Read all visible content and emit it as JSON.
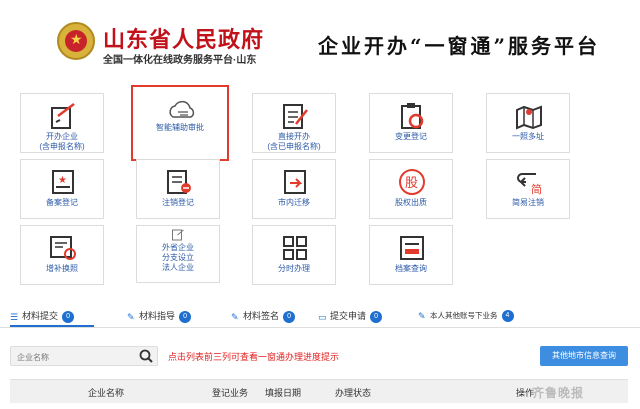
{
  "header": {
    "gov_title": "山东省人民政府",
    "gov_subtitle": "全国一体化在线政务服务平台·山东",
    "platform_title": "企业开办“一窗通”服务平台"
  },
  "tiles": [
    {
      "label": "开办企业",
      "label2": "(含申报名称)",
      "icon": "edit-document-icon"
    },
    {
      "label": "智能辅助审批",
      "label2": "",
      "icon": "cloud-icon",
      "highlighted": true
    },
    {
      "label": "直接开办",
      "label2": "(含已申报名称)",
      "icon": "pen-document-icon"
    },
    {
      "label": "变更登记",
      "label2": "",
      "icon": "refresh-clipboard-icon"
    },
    {
      "label": "一照多址",
      "label2": "",
      "icon": "map-icon"
    },
    {
      "label": "备案登记",
      "label2": "",
      "icon": "star-folder-icon"
    },
    {
      "label": "注销登记",
      "label2": "",
      "icon": "cancel-document-icon"
    },
    {
      "label": "市内迁移",
      "label2": "",
      "icon": "move-document-icon"
    },
    {
      "label": "股权出质",
      "label2": "",
      "icon": "stock-icon",
      "icon_text": "股"
    },
    {
      "label": "简易注销",
      "label2": "",
      "icon": "simple-cancel-icon",
      "icon_text": "简"
    },
    {
      "label": "增补换照",
      "label2": "",
      "icon": "certificate-icon"
    },
    {
      "label": "外省企业",
      "label2": "分支设立",
      "label3": "法人企业",
      "icon": "branch-icon"
    },
    {
      "label": "分时办理",
      "label2": "",
      "icon": "grid-icon"
    },
    {
      "label": "档案查询",
      "label2": "",
      "icon": "archive-icon"
    }
  ],
  "tabs": [
    {
      "label": "材料提交",
      "count": "0",
      "active": true
    },
    {
      "label": "材料指导",
      "count": "0"
    },
    {
      "label": "材料签名",
      "count": "0"
    },
    {
      "label": "提交申请",
      "count": "0"
    },
    {
      "label": "本人其他账号下业务",
      "count": "4"
    }
  ],
  "search": {
    "placeholder": "企业名称"
  },
  "hint": "点击列表前三列可查看一窗通办理进度提示",
  "query_button": "其他地市信息查询",
  "table": {
    "columns": [
      "企业名称",
      "登记业务",
      "填报日期",
      "办理状态",
      "操作"
    ]
  },
  "watermark": "齐鲁晚报",
  "colors": {
    "brand_red": "#c1121c",
    "accent_blue": "#1e6fd0",
    "tile_text": "#2b5aa8",
    "hint_red": "#e02020"
  }
}
